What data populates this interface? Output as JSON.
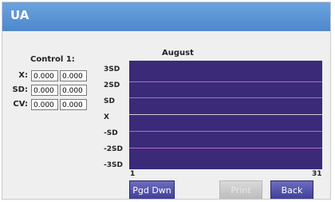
{
  "titlebar": {
    "title": "UA"
  },
  "control": {
    "title": "Control 1:",
    "rows": [
      {
        "label": "X:",
        "value1": "0.000",
        "value2": "0.000"
      },
      {
        "label": "SD:",
        "value1": "0.000",
        "value2": "0.000"
      },
      {
        "label": "CV:",
        "value1": "0.000",
        "value2": "0.000"
      }
    ]
  },
  "chart": {
    "title": "August",
    "y_labels": [
      "3SD",
      "2SD",
      "SD",
      "X",
      "-SD",
      "-2SD",
      "-3SD"
    ],
    "x_start": "1",
    "x_end": "31"
  },
  "buttons": {
    "page_down": "Pgd Dwn",
    "print": "Print",
    "back": "Back"
  },
  "colors": {
    "titlebar": "#5a95d7",
    "plot_background": "#3a2a78",
    "limit_line": "#b06bd0",
    "mean_line": "#d0d0d0",
    "button": "#4b4aa6",
    "button_disabled": "#c9c9c9"
  }
}
